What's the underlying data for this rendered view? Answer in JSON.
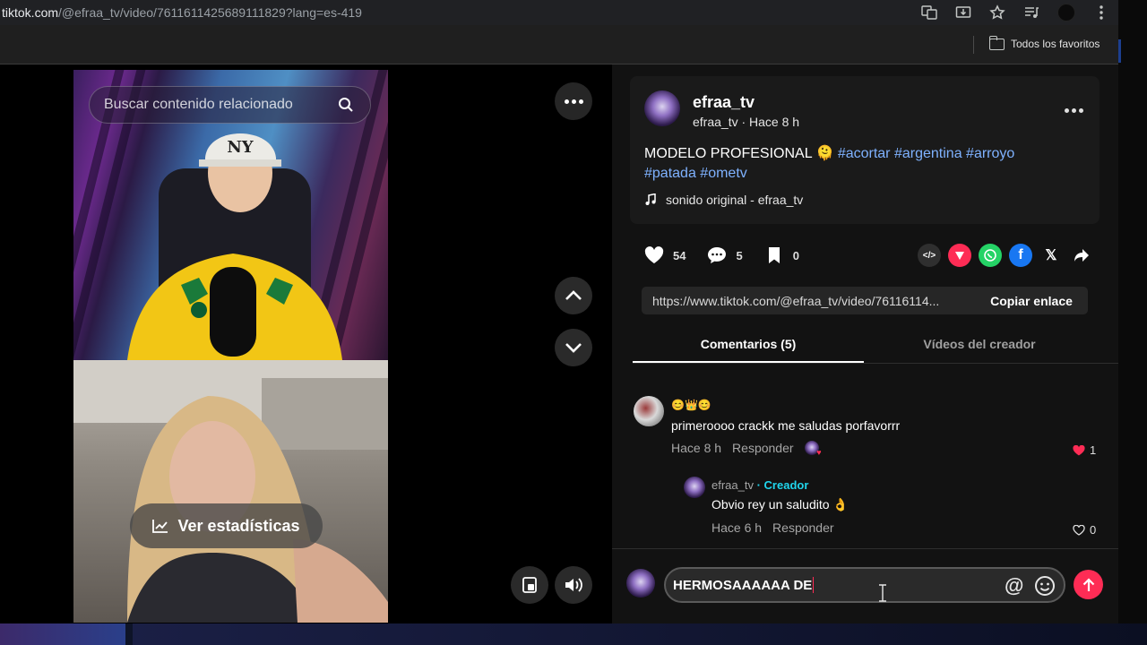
{
  "browser": {
    "url_host": "tiktok.com",
    "url_path": "/@efraa_tv/video/7611611425689111829?lang=es-419",
    "bookmarks_folder": "Todos los favoritos"
  },
  "video": {
    "search_placeholder": "Buscar contenido relacionado",
    "stats_button": "Ver estadísticas"
  },
  "post": {
    "author": "efraa_tv",
    "author_meta": "efraa_tv · Hace 8 h",
    "caption_text": "MODELO PROFESIONAL 🫠 ",
    "hashtags": [
      "#acortar",
      "#argentina",
      "#arroyo",
      "#patada",
      "#ometv"
    ],
    "sound": "sonido original - efraa_tv"
  },
  "stats": {
    "likes": "54",
    "comments": "5",
    "saves": "0"
  },
  "share": {
    "link": "https://www.tiktok.com/@efraa_tv/video/76116114...",
    "copy_label": "Copiar enlace"
  },
  "tabs": {
    "comments": "Comentarios (5)",
    "creator_videos": "Vídeos del creador"
  },
  "comments": [
    {
      "emojis": "😊👑😊",
      "text": "primeroooo crackk me saludas porfavorrr",
      "time": "Hace 8 h",
      "reply_label": "Responder",
      "likes": "1"
    }
  ],
  "reply": {
    "user": "efraa_tv",
    "badge": " · Creador",
    "text": "Obvio rey un saludito 👌",
    "time": "Hace 6 h",
    "reply_label": "Responder",
    "likes": "0"
  },
  "composer": {
    "text": "HERMOSAAAAAA DE"
  },
  "colors": {
    "accent": "#fe2c55",
    "hashtag": "#7fb2ff",
    "creator_badge": "#20d5ec",
    "panel_bg": "#121212"
  }
}
